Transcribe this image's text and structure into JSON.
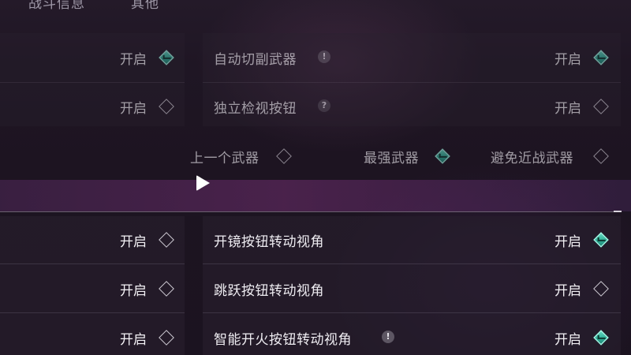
{
  "tabs": {
    "tab1": "战斗信息",
    "tab2": "其他"
  },
  "upper": {
    "rows": [
      {
        "left_value": "开启",
        "left_checked": true,
        "label": "自动切副武器",
        "badge": "!",
        "right_value": "开启",
        "right_checked": true
      },
      {
        "left_value": "开启",
        "left_checked": false,
        "label": "独立检视按钮",
        "badge": "?",
        "right_value": "开启",
        "right_checked": false
      }
    ],
    "weapon_options": [
      {
        "label": "上一个武器",
        "checked": false
      },
      {
        "label": "最强武器",
        "checked": true
      },
      {
        "label": "避免近战武器",
        "checked": false
      }
    ]
  },
  "lower": {
    "rows": [
      {
        "left_value": "开启",
        "left_checked": false,
        "label": "开镜按钮转动视角",
        "badge": "",
        "right_value": "开启",
        "right_checked": true
      },
      {
        "left_value": "开启",
        "left_checked": false,
        "label": "跳跃按钮转动视角",
        "badge": "",
        "right_value": "开启",
        "right_checked": false
      },
      {
        "left_value": "开启",
        "left_checked": false,
        "label": "智能开火按钮转动视角",
        "badge": "!",
        "right_value": "开启",
        "right_checked": true
      }
    ]
  },
  "colors": {
    "accent": "#3fbfa6",
    "text": "#efedf2",
    "panel": "#2a2230"
  }
}
